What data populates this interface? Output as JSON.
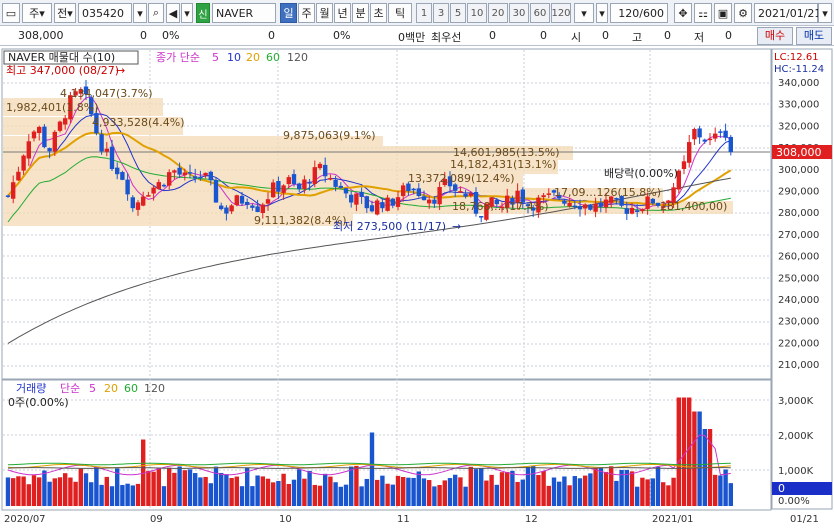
{
  "toolbar": {
    "market_select": "주",
    "type_select": "전",
    "code": "035420",
    "security_badge": "신",
    "name": "NAVER",
    "periods": [
      "일",
      "주",
      "월",
      "년",
      "분",
      "초",
      "틱"
    ],
    "active_period": "일",
    "intervals": [
      "1",
      "3",
      "5",
      "10",
      "20",
      "30",
      "60",
      "120"
    ],
    "count": "120/600",
    "date": "2021/01/21"
  },
  "info": {
    "price": "308,000",
    "change": "0",
    "change_pct": "0%",
    "v1": "0",
    "v1_pct": "0%",
    "amount_label": "0백만",
    "priority": "최우선",
    "bid_qty": "0",
    "ask_qty": "0",
    "open_label": "시",
    "open_value": "0",
    "high_label": "고",
    "high_value": "0",
    "low_label": "저",
    "low_value": "0",
    "buy_label": "매수",
    "sell_label": "매도"
  },
  "price_panel": {
    "title": "NAVER 매물대 수(10)",
    "ma_label": "종가 단순",
    "ma_periods": [
      "5",
      "10",
      "20",
      "60",
      "120"
    ],
    "ma_colors": [
      "#cc33cc",
      "#2233cc",
      "#e0a000",
      "#22aa33",
      "#555555"
    ],
    "lc": "LC:12.61",
    "hc": "HC:-11.24",
    "current_price": "308,000",
    "y_ticks": [
      "340,000",
      "330,000",
      "320,000",
      "310,000",
      "300,000",
      "290,000",
      "280,000",
      "270,000",
      "260,000",
      "250,000",
      "240,000",
      "230,000",
      "220,000",
      "210,000"
    ],
    "high_marker": "최고 347,000 (08/27)",
    "low_marker": "최저 273,500 (11/17)",
    "dividend_label": "배당락(0.00%)",
    "volume_profile": [
      "1,982,401(1.8%)",
      "4,134,047(3.7%)",
      "4,933,528(4.4%)",
      "9,875,063(9.1%)",
      "14,601,985(13.5%)",
      "14,182,431(13.1%)",
      "13,372,089(12.4%)",
      "17,09…126(15.8%)",
      "18,768,…(17.4%)",
      "281,400,00)",
      "9,111,382(8.4%)"
    ]
  },
  "volume_panel": {
    "title": "거래량",
    "ma_label": "단순",
    "ma_periods": [
      "5",
      "20",
      "60",
      "120"
    ],
    "value_label": "0주(0.00%)",
    "y_ticks": [
      "3,000K",
      "2,000K",
      "1,000K"
    ],
    "current": "0",
    "pct": "0.00%"
  },
  "x_axis": [
    "2020/07",
    "09",
    "10",
    "11",
    "12",
    "2021/01",
    "01/21"
  ]
}
